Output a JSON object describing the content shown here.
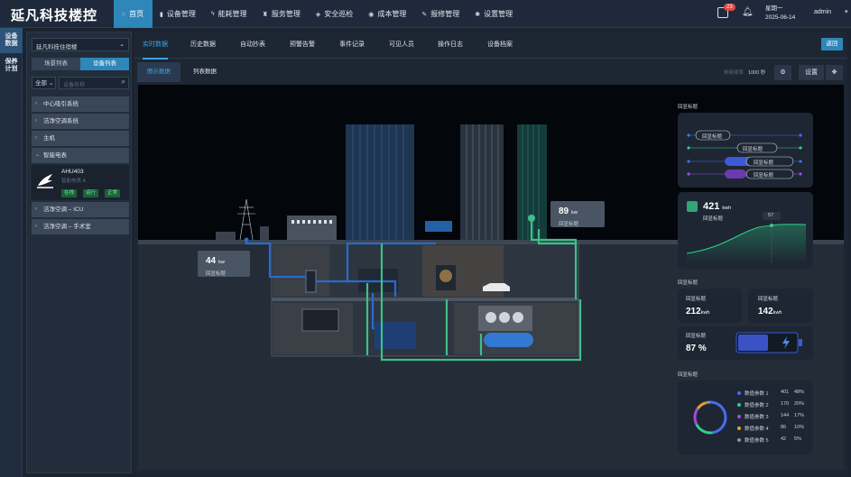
{
  "brand": "延凡科技楼控",
  "nav": [
    {
      "label": "首页",
      "icon": "home-icon",
      "glyph": "⌂"
    },
    {
      "label": "设备管理",
      "icon": "device-icon",
      "glyph": "▮"
    },
    {
      "label": "能耗管理",
      "icon": "energy-icon",
      "glyph": "ϟ"
    },
    {
      "label": "服务管理",
      "icon": "service-icon",
      "glyph": "♜"
    },
    {
      "label": "安全巡检",
      "icon": "shield-icon",
      "glyph": "◈"
    },
    {
      "label": "成本管理",
      "icon": "cost-icon",
      "glyph": "◉"
    },
    {
      "label": "报修管理",
      "icon": "wrench-icon",
      "glyph": "✎"
    },
    {
      "label": "设置管理",
      "icon": "settings-icon",
      "glyph": "✱"
    }
  ],
  "header": {
    "mail_badge": "23",
    "weekday": "星期一",
    "date": "2025-06-14",
    "user": "admin"
  },
  "rail": [
    {
      "label": "设备\n数据"
    },
    {
      "label": "保养\n计划"
    }
  ],
  "sidebar": {
    "building": "延凡科技住宿楼",
    "seg": [
      "场景列表",
      "设备列表"
    ],
    "filter_all": "全部",
    "search_placeholder": "设备名称",
    "tree": [
      "中心吸引系统",
      "洁净空调系统",
      "主机",
      "智能电表"
    ],
    "device": {
      "name": "AHU403",
      "sub": "智能电表 A",
      "tags": [
        "在线",
        "运行",
        "正常"
      ]
    },
    "tree2": [
      "洁净空调 – ICU",
      "洁净空调 – 手术室"
    ]
  },
  "tabs": [
    "实时数据",
    "历史数据",
    "自动抄表",
    "预警告警",
    "事件记录",
    "可见人员",
    "操作日志",
    "设备档案"
  ],
  "back_label": "返回",
  "subtabs": [
    "图示数据",
    "列表数据"
  ],
  "refresh": {
    "label": "刷新频率",
    "value": "1000 秒"
  },
  "tools": {
    "settings": "设置"
  },
  "scene": {
    "bubble_top": {
      "value": "89",
      "unit": "kw",
      "label": "回显标题"
    },
    "bubble_left": {
      "value": "44",
      "unit": "kw",
      "label": "回显标题"
    }
  },
  "right": {
    "t1": "回显标题",
    "flow": [
      "回显标题",
      "回显标题",
      "回显标题",
      "回显标题"
    ],
    "kwh": {
      "value": "421",
      "unit": "kwh",
      "label": "回显标题",
      "peak": "57"
    },
    "t2": "回显标题",
    "m1": {
      "label": "回显标题",
      "value": "212",
      "unit": "kwh"
    },
    "m2": {
      "label": "回显标题",
      "value": "142",
      "unit": "kwh"
    },
    "m3": {
      "label": "回显标题",
      "value": "87 %"
    },
    "t3": "回显标题",
    "legend": [
      {
        "name": "数值参数 1",
        "v": "401",
        "p": "48%",
        "color": "#4a6cf0"
      },
      {
        "name": "数值参数 2",
        "v": "170",
        "p": "20%",
        "color": "#2fd08a"
      },
      {
        "name": "数值参数 3",
        "v": "144",
        "p": "17%",
        "color": "#a24ce0"
      },
      {
        "name": "数值参数 4",
        "v": "86",
        "p": "10%",
        "color": "#f0a020"
      },
      {
        "name": "数值参数 5",
        "v": "42",
        "p": "5%",
        "color": "#8a939e"
      }
    ]
  }
}
